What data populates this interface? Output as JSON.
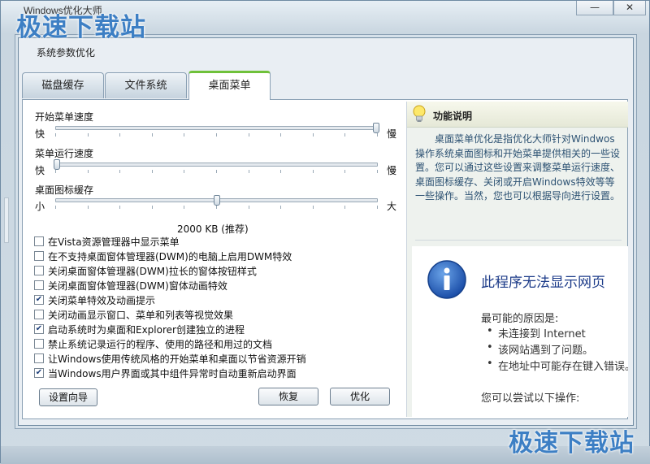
{
  "app": {
    "title": "Windows优化大师"
  },
  "window_buttons": {
    "minimize": "—",
    "close": "✕"
  },
  "watermark": {
    "top": "极速下载站",
    "bottom": "极速下载站"
  },
  "dialog": {
    "title": "系统参数优化"
  },
  "tabs": [
    {
      "label": "磁盘缓存",
      "active": false
    },
    {
      "label": "文件系统",
      "active": false
    },
    {
      "label": "桌面菜单",
      "active": true
    }
  ],
  "sliders": [
    {
      "label": "开始菜单速度",
      "left": "快",
      "right": "慢",
      "value": 1.0
    },
    {
      "label": "菜单运行速度",
      "left": "快",
      "right": "慢",
      "value": 0.0
    },
    {
      "label": "桌面图标缓存",
      "left": "小",
      "right": "大",
      "value": 0.5
    }
  ],
  "cache_value": "2000 KB (推荐)",
  "options": [
    {
      "label": "在Vista资源管理器中显示菜单",
      "checked": false
    },
    {
      "label": "在不支持桌面窗体管理器(DWM)的电脑上启用DWM特效",
      "checked": false
    },
    {
      "label": "关闭桌面窗体管理器(DWM)拉长的窗体按钮样式",
      "checked": false
    },
    {
      "label": "关闭桌面窗体管理器(DWM)窗体动画特效",
      "checked": false
    },
    {
      "label": "关闭菜单特效及动画提示",
      "checked": true
    },
    {
      "label": "关闭动画显示窗口、菜单和列表等视觉效果",
      "checked": false
    },
    {
      "label": "启动系统时为桌面和Explorer创建独立的进程",
      "checked": true
    },
    {
      "label": "禁止系统记录运行的程序、使用的路径和用过的文档",
      "checked": false
    },
    {
      "label": "让Windows使用传统风格的开始菜单和桌面以节省资源开销",
      "checked": false
    },
    {
      "label": "当Windows用户界面或其中组件异常时自动重新启动界面",
      "checked": true
    }
  ],
  "buttons": {
    "wizard": "设置向导",
    "restore": "恢复",
    "optimize": "优化"
  },
  "help": {
    "title": "功能说明",
    "text": "桌面菜单优化是指优化大师针对Windwos操作系统桌面图标和开始菜单提供相关的一些设置。您可以通过这些设置来调整菜单运行速度、桌面图标缓存、关闭或开启Windows特效等等一些操作。当然，您也可以根据导向进行设置。"
  },
  "browser_error": {
    "heading": "此程序无法显示网页",
    "reason": "最可能的原因是:",
    "items": [
      "未连接到 Internet",
      "该网站遇到了问题。",
      "在地址中可能存在键入错误。"
    ],
    "try": "您可以尝试以下操作:"
  },
  "colors": {
    "accent_tab": "#6fc13a",
    "help_text": "#2d5273",
    "error_heading": "#1b3a88",
    "watermark": "#3d7fc4"
  }
}
